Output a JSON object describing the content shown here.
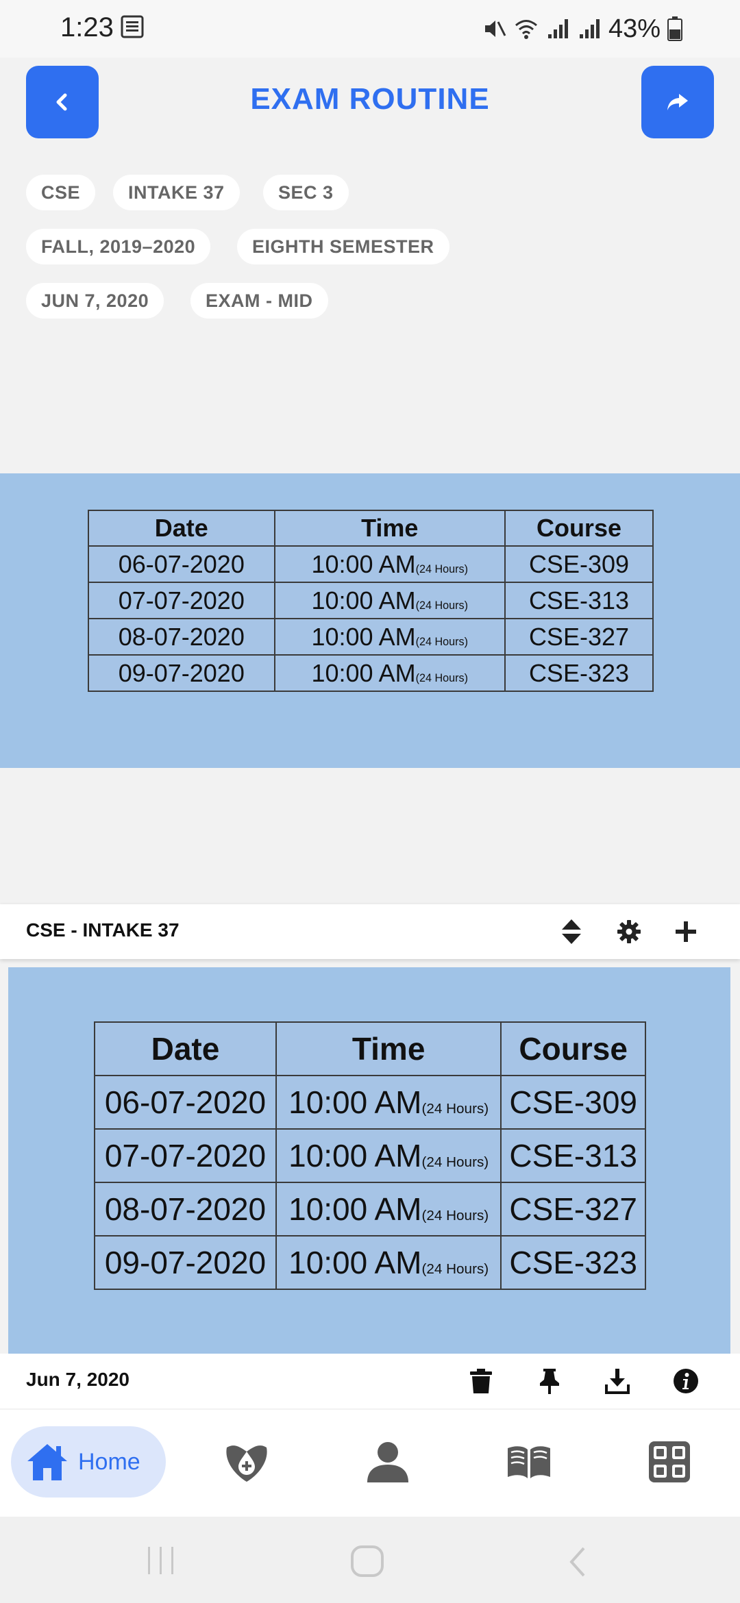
{
  "status_bar": {
    "time": "1:23",
    "battery": "43%"
  },
  "header": {
    "title": "EXAM ROUTINE"
  },
  "chips": [
    "CSE",
    "INTAKE 37",
    "SEC 3",
    "FALL, 2019–2020",
    "EIGHTH SEMESTER",
    "JUN 7, 2020",
    "EXAM - MID"
  ],
  "routine": {
    "headers": [
      "Date",
      "Time",
      "Course"
    ],
    "time_note": "(24 Hours)",
    "rows": [
      {
        "date": "06-07-2020",
        "time": "10:00 AM",
        "course": "CSE-309"
      },
      {
        "date": "07-07-2020",
        "time": "10:00 AM",
        "course": "CSE-313"
      },
      {
        "date": "08-07-2020",
        "time": "10:00 AM",
        "course": "CSE-327"
      },
      {
        "date": "09-07-2020",
        "time": "10:00 AM",
        "course": "CSE-323"
      }
    ]
  },
  "card": {
    "title": "CSE - INTAKE 37",
    "date": "Jun 7, 2020"
  },
  "bottom_nav": {
    "home_label": "Home"
  },
  "colors": {
    "accent": "#2f6ff0",
    "image_bg": "#a0c3e7",
    "home_pill": "#dce6fb"
  }
}
